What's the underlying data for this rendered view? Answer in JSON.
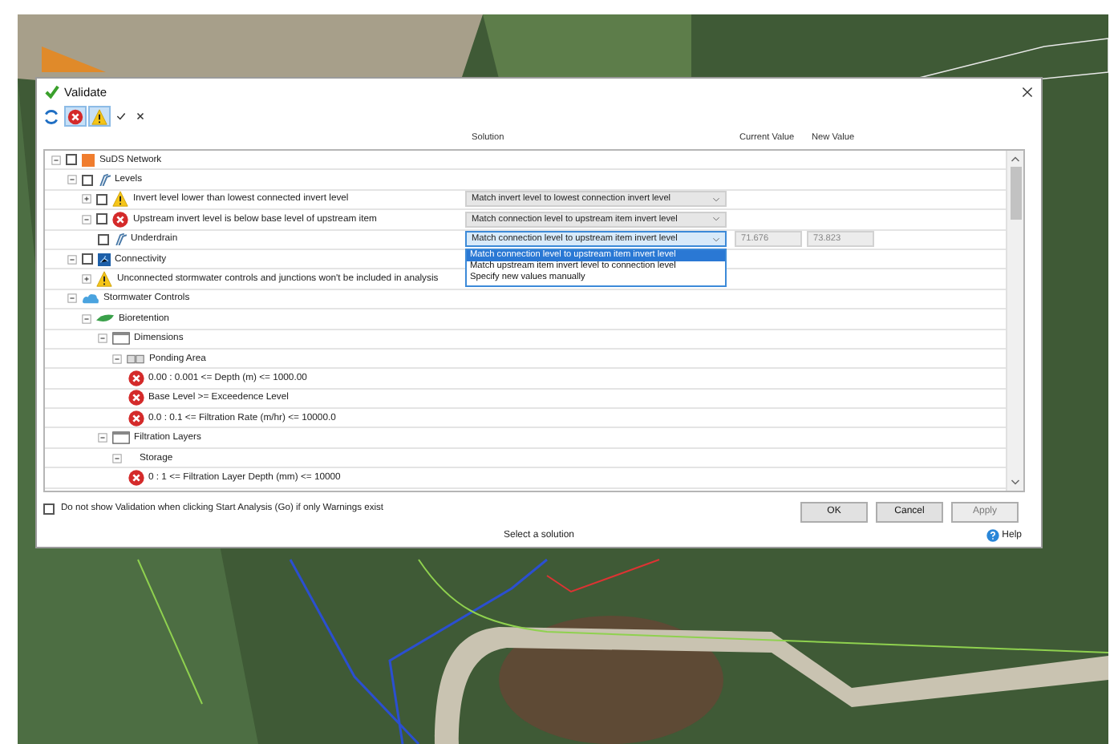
{
  "window": {
    "title": "Validate"
  },
  "toolbar": [
    {
      "kind": "refresh"
    },
    {
      "kind": "error",
      "selected": true
    },
    {
      "kind": "warning",
      "selected": true
    },
    {
      "kind": "check"
    },
    {
      "kind": "cross"
    }
  ],
  "columns": [
    "Solution",
    "Current Value",
    "New Value"
  ],
  "tree": [
    {
      "label": "SuDS Network",
      "kind": "network",
      "expanded": true,
      "checked": false,
      "children": [
        {
          "label": "Levels",
          "kind": "levels",
          "expanded": true,
          "checked": false,
          "children": [
            {
              "label": "Invert level lower than lowest connected invert level",
              "kind": "warning",
              "expanded": false,
              "checked": false,
              "solution": {
                "value": "Match invert level to lowest connection invert level",
                "open": false
              }
            },
            {
              "label": "Upstream invert level is below base level of upstream item",
              "kind": "error",
              "expanded": true,
              "checked": false,
              "solution": {
                "value": "Match connection level to upstream item invert level",
                "open": false
              },
              "children": [
                {
                  "label": "Underdrain",
                  "kind": "levels",
                  "checked": false,
                  "solution": {
                    "value": "Match connection level to upstream item invert level",
                    "open": true,
                    "options": [
                      {
                        "label": "Match connection level to upstream item invert level",
                        "selected": true
                      },
                      {
                        "label": "Match upstream item invert level to connection level",
                        "selected": false
                      },
                      {
                        "label": "Specify new values manually",
                        "selected": false
                      }
                    ]
                  },
                  "current_value": "71.676",
                  "new_value": "73.823"
                }
              ]
            }
          ]
        },
        {
          "label": "Connectivity",
          "kind": "connectivity",
          "expanded": true,
          "checked": false,
          "children": [
            {
              "label": "Unconnected stormwater controls and junctions won't be included in analysis",
              "kind": "warning",
              "expanded": false
            }
          ]
        },
        {
          "label": "Stormwater Controls",
          "kind": "controls",
          "expanded": true,
          "children": [
            {
              "label": "Bioretention",
              "kind": "bioretention",
              "expanded": true,
              "children": [
                {
                  "label": "Dimensions",
                  "kind": "dimensions",
                  "expanded": true,
                  "children": [
                    {
                      "label": "Ponding Area",
                      "kind": "ponding",
                      "expanded": true,
                      "children": [
                        {
                          "label": "0.00 : 0.001 <= Depth (m) <= 1000.00",
                          "kind": "error"
                        },
                        {
                          "label": "Base Level >= Exceedence Level",
                          "kind": "error"
                        },
                        {
                          "label": "0.0 : 0.1 <= Filtration Rate (m/hr) <= 10000.0",
                          "kind": "error"
                        }
                      ]
                    }
                  ]
                },
                {
                  "label": "Filtration Layers",
                  "kind": "dimensions",
                  "expanded": true,
                  "children": [
                    {
                      "label": "Storage",
                      "expanded": true,
                      "children": [
                        {
                          "label": "0 : 1 <= Filtration Layer Depth (mm) <= 10000",
                          "kind": "error"
                        }
                      ]
                    }
                  ]
                }
              ]
            }
          ]
        }
      ]
    }
  ],
  "dont_show": {
    "label": "Do not show Validation when clicking Start Analysis (Go) if only Warnings exist",
    "checked": false
  },
  "buttons": [
    {
      "label": "OK",
      "disabled": false
    },
    {
      "label": "Cancel",
      "disabled": false
    },
    {
      "label": "Apply",
      "disabled": true
    }
  ],
  "status": "Select a solution",
  "help": "Help"
}
